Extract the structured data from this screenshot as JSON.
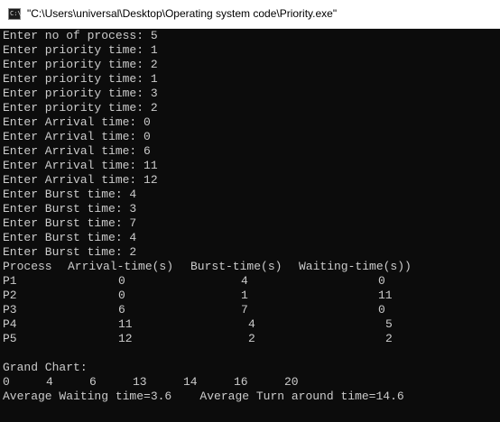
{
  "window": {
    "title": "\"C:\\Users\\universal\\Desktop\\Operating system code\\Priority.exe\""
  },
  "console": {
    "prompts": [
      "Enter no of process: 5",
      "Enter priority time: 1",
      "Enter priority time: 2",
      "Enter priority time: 1",
      "Enter priority time: 3",
      "Enter priority time: 2",
      "Enter Arrival time: 0",
      "Enter Arrival time: 0",
      "Enter Arrival time: 6",
      "Enter Arrival time: 11",
      "Enter Arrival time: 12",
      "Enter Burst time: 4",
      "Enter Burst time: 3",
      "Enter Burst time: 7",
      "Enter Burst time: 4",
      "Enter Burst time: 2"
    ],
    "table": {
      "header": [
        "Process",
        "Arrival-time(s)",
        "Burst-time(s)",
        "Waiting-time(s))"
      ],
      "rows": [
        [
          "P1",
          "0",
          "4",
          "0"
        ],
        [
          "P2",
          "0",
          "1",
          "11"
        ],
        [
          "P3",
          "6",
          "7",
          "0"
        ],
        [
          "P4",
          "11",
          "4",
          "5"
        ],
        [
          "P5",
          "12",
          "2",
          "2"
        ]
      ]
    },
    "grand_chart_label": "Grand Chart:",
    "grand_chart_times": [
      "0",
      "4",
      "6",
      "13",
      "14",
      "16",
      "20"
    ],
    "averages": "Average Waiting time=3.6    Average Turn around time=14.6"
  }
}
